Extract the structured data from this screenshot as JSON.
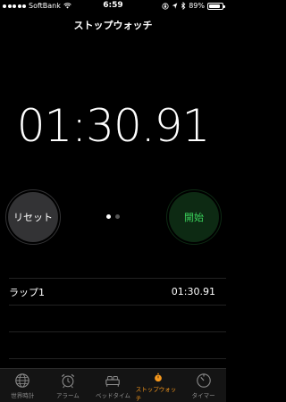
{
  "status_bar": {
    "carrier": "SoftBank",
    "time": "6:59",
    "battery_percent": "89%",
    "battery_level": 0.89
  },
  "nav": {
    "title": "ストップウォッチ"
  },
  "stopwatch": {
    "time": "01:30.91",
    "reset_label": "リセット",
    "start_label": "開始",
    "page_index": 0,
    "page_count": 2
  },
  "laps": [
    {
      "label": "ラップ1",
      "time": "01:30.91"
    }
  ],
  "tabs": [
    {
      "label": "世界時計",
      "icon": "globe-icon",
      "active": false
    },
    {
      "label": "アラーム",
      "icon": "alarm-clock-icon",
      "active": false
    },
    {
      "label": "ベッドタイム",
      "icon": "bed-icon",
      "active": false
    },
    {
      "label": "ストップウォッチ",
      "icon": "stopwatch-icon",
      "active": true
    },
    {
      "label": "タイマー",
      "icon": "timer-icon",
      "active": false
    }
  ],
  "colors": {
    "accent": "#f7981c",
    "start_green": "#3ad15b",
    "start_bg": "#0d2a13",
    "reset_bg": "#333335"
  }
}
